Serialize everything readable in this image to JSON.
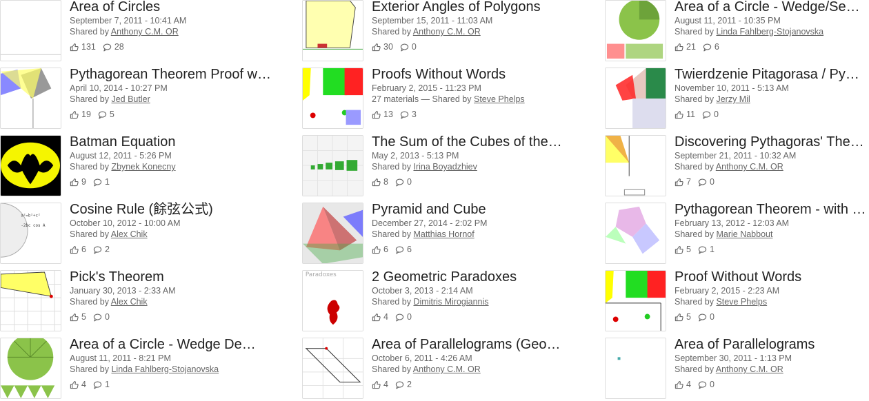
{
  "cards": [
    {
      "title": "Area of Circles",
      "date": "September 7, 2011 - 10:41 AM",
      "shared_prefix": "Shared by",
      "author": "Anthony C.M. OR",
      "likes": "131",
      "comments": "28",
      "materials": ""
    },
    {
      "title": "Exterior Angles of Polygons",
      "date": "September 15, 2011 - 11:03 AM",
      "shared_prefix": "Shared by",
      "author": "Anthony C.M. OR",
      "likes": "30",
      "comments": "0",
      "materials": ""
    },
    {
      "title": "Area of a Circle - Wedge/Se…",
      "date": "August 11, 2011 - 10:35 PM",
      "shared_prefix": "Shared by",
      "author": "Linda Fahlberg-Stojanovska",
      "likes": "21",
      "comments": "6",
      "materials": ""
    },
    {
      "title": "Pythagorean Theorem Proof w…",
      "date": "April 10, 2014 - 10:27 PM",
      "shared_prefix": "Shared by",
      "author": "Jed Butler",
      "likes": "19",
      "comments": "5",
      "materials": ""
    },
    {
      "title": "Proofs Without Words",
      "date": "February 2, 2015 - 11:23 PM",
      "shared_prefix": "27 materials — Shared by",
      "author": "Steve Phelps",
      "likes": "13",
      "comments": "3",
      "materials": ""
    },
    {
      "title": "Twierdzenie Pitagorasa / Py…",
      "date": "November 10, 2011 - 5:13 AM",
      "shared_prefix": "Shared by",
      "author": "Jerzy Mil",
      "likes": "11",
      "comments": "0",
      "materials": ""
    },
    {
      "title": "Batman Equation",
      "date": "August 12, 2011 - 5:26 PM",
      "shared_prefix": "Shared by",
      "author": "Zbynek Konecny",
      "likes": "9",
      "comments": "1",
      "materials": ""
    },
    {
      "title": "The Sum of the Cubes of the…",
      "date": "May 2, 2013 - 5:13 PM",
      "shared_prefix": "Shared by",
      "author": "Irina Boyadzhiev",
      "likes": "8",
      "comments": "0",
      "materials": ""
    },
    {
      "title": "Discovering Pythagoras' The…",
      "date": "September 21, 2011 - 10:32 AM",
      "shared_prefix": "Shared by",
      "author": "Anthony C.M. OR",
      "likes": "7",
      "comments": "0",
      "materials": ""
    },
    {
      "title": "Cosine Rule (餘弦公式)",
      "date": "October 10, 2012 - 10:00 AM",
      "shared_prefix": "Shared by",
      "author": "Alex Chik",
      "likes": "6",
      "comments": "2",
      "materials": ""
    },
    {
      "title": "Pyramid and Cube",
      "date": "December 27, 2014 - 2:02 PM",
      "shared_prefix": "Shared by",
      "author": "Matthias Hornof",
      "likes": "6",
      "comments": "6",
      "materials": ""
    },
    {
      "title": "Pythagorean Theorem - with …",
      "date": "February 13, 2012 - 12:03 AM",
      "shared_prefix": "Shared by",
      "author": "Marie Nabbout",
      "likes": "5",
      "comments": "1",
      "materials": ""
    },
    {
      "title": "Pick's Theorem",
      "date": "January 30, 2013 - 2:33 AM",
      "shared_prefix": "Shared by",
      "author": "Alex Chik",
      "likes": "5",
      "comments": "0",
      "materials": ""
    },
    {
      "title": "2 Geometric Paradoxes",
      "date": "October 3, 2013 - 2:14 AM",
      "shared_prefix": "Shared by",
      "author": "Dimitris Mirogiannis",
      "likes": "4",
      "comments": "0",
      "materials": ""
    },
    {
      "title": "Proof Without Words",
      "date": "February 2, 2015 - 2:23 AM",
      "shared_prefix": "Shared by",
      "author": "Steve Phelps",
      "likes": "5",
      "comments": "0",
      "materials": ""
    },
    {
      "title": "Area of a Circle - Wedge De…",
      "date": "August 11, 2011 - 8:21 PM",
      "shared_prefix": "Shared by",
      "author": "Linda Fahlberg-Stojanovska",
      "likes": "4",
      "comments": "1",
      "materials": ""
    },
    {
      "title": "Area of Parallelograms (Geo…",
      "date": "October 6, 2011 - 4:26 AM",
      "shared_prefix": "Shared by",
      "author": "Anthony C.M. OR",
      "likes": "4",
      "comments": "2",
      "materials": ""
    },
    {
      "title": "Area of Parallelograms",
      "date": "September 30, 2011 - 1:13 PM",
      "shared_prefix": "Shared by",
      "author": "Anthony C.M. OR",
      "likes": "4",
      "comments": "0",
      "materials": ""
    }
  ],
  "thumb_labels": {
    "paradox": "Paradoxes"
  },
  "icons": {
    "like": "thumbs-up-icon",
    "comment": "comment-bubble-icon"
  }
}
